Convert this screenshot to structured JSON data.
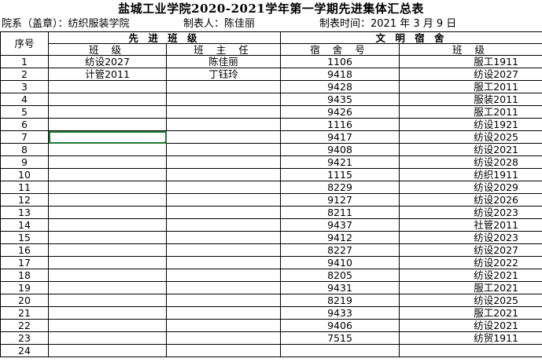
{
  "title": "盐城工业学院2020-2021学年第一学期先进集体汇总表",
  "meta": {
    "department": "院系（盖章）：纺织服装学院",
    "preparer": "制表人：陈佳丽",
    "date": "制表时间：2021 年 3 月  9 日"
  },
  "headers": {
    "seq": "序号",
    "advanced_class": "先 进 班 级",
    "civilized_dorm": "文 明 宿 舍",
    "class_col": "班  级",
    "teacher_col": "班 主 任",
    "dorm_col": "宿 舍 号",
    "dorm_class_col": "班  级"
  },
  "rows": [
    {
      "seq": "1",
      "cls": "纺设2027",
      "teacher": "陈佳丽",
      "dorm": "1106",
      "dcls": "服工1911"
    },
    {
      "seq": "2",
      "cls": "计管2011",
      "teacher": "丁钰玲",
      "dorm": "9418",
      "dcls": "纺设2027"
    },
    {
      "seq": "3",
      "cls": "",
      "teacher": "",
      "dorm": "9428",
      "dcls": "服工2011"
    },
    {
      "seq": "4",
      "cls": "",
      "teacher": "",
      "dorm": "9435",
      "dcls": "服装2011"
    },
    {
      "seq": "5",
      "cls": "",
      "teacher": "",
      "dorm": "9426",
      "dcls": "服工2011"
    },
    {
      "seq": "6",
      "cls": "",
      "teacher": "",
      "dorm": "1116",
      "dcls": "纺设1921"
    },
    {
      "seq": "7",
      "cls": "",
      "teacher": "",
      "dorm": "9417",
      "dcls": "纺设2025"
    },
    {
      "seq": "8",
      "cls": "",
      "teacher": "",
      "dorm": "9408",
      "dcls": "纺设2021"
    },
    {
      "seq": "9",
      "cls": "",
      "teacher": "",
      "dorm": "9421",
      "dcls": "纺设2028"
    },
    {
      "seq": "10",
      "cls": "",
      "teacher": "",
      "dorm": "1115",
      "dcls": "纺织1911"
    },
    {
      "seq": "11",
      "cls": "",
      "teacher": "",
      "dorm": "8229",
      "dcls": "纺设2029"
    },
    {
      "seq": "12",
      "cls": "",
      "teacher": "",
      "dorm": "9127",
      "dcls": "纺设2026"
    },
    {
      "seq": "13",
      "cls": "",
      "teacher": "",
      "dorm": "8211",
      "dcls": "纺设2023"
    },
    {
      "seq": "14",
      "cls": "",
      "teacher": "",
      "dorm": "9437",
      "dcls": "社管2011"
    },
    {
      "seq": "15",
      "cls": "",
      "teacher": "",
      "dorm": "9412",
      "dcls": "纺设2023"
    },
    {
      "seq": "16",
      "cls": "",
      "teacher": "",
      "dorm": "8227",
      "dcls": "纺设2027"
    },
    {
      "seq": "17",
      "cls": "",
      "teacher": "",
      "dorm": "9410",
      "dcls": "纺设2022"
    },
    {
      "seq": "18",
      "cls": "",
      "teacher": "",
      "dorm": "8205",
      "dcls": "纺设2021"
    },
    {
      "seq": "19",
      "cls": "",
      "teacher": "",
      "dorm": "9431",
      "dcls": "服工2021"
    },
    {
      "seq": "20",
      "cls": "",
      "teacher": "",
      "dorm": "8219",
      "dcls": "纺设2025"
    },
    {
      "seq": "21",
      "cls": "",
      "teacher": "",
      "dorm": "9433",
      "dcls": "服工2021"
    },
    {
      "seq": "22",
      "cls": "",
      "teacher": "",
      "dorm": "9406",
      "dcls": "纺设2021"
    },
    {
      "seq": "23",
      "cls": "",
      "teacher": "",
      "dorm": "7515",
      "dcls": "纺贸1911"
    },
    {
      "seq": "24",
      "cls": "",
      "teacher": "",
      "dorm": "",
      "dcls": ""
    }
  ],
  "colors": {
    "selection": "#1e7b34",
    "grid": "#000000"
  }
}
